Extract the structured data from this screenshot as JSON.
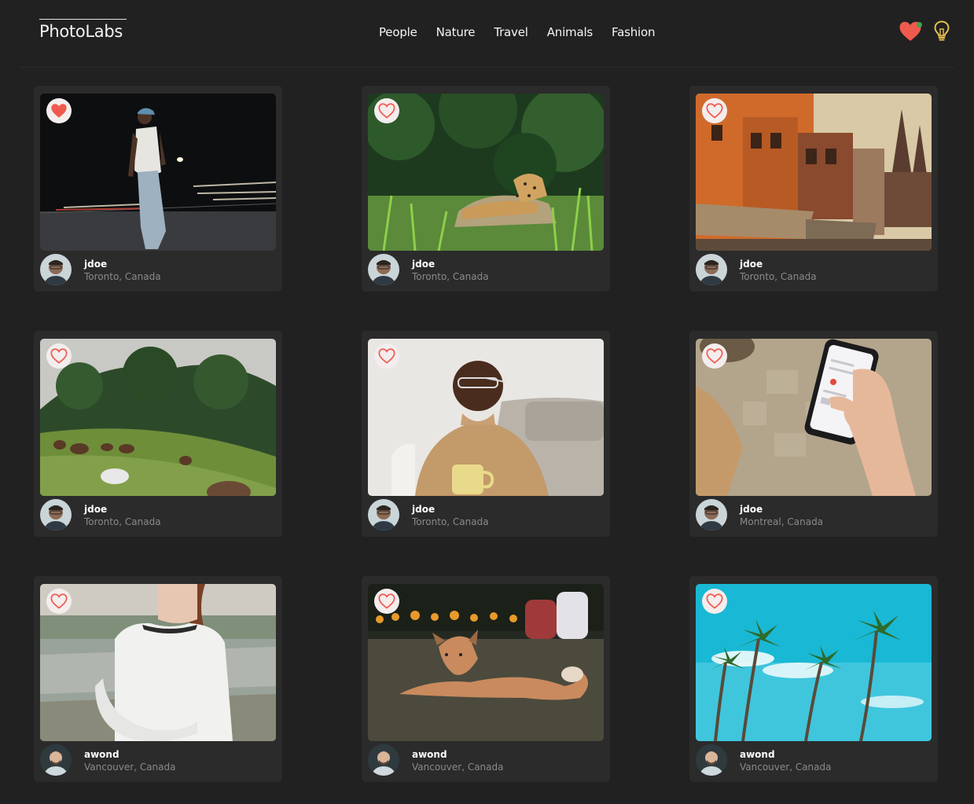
{
  "header": {
    "logo": "PhotoLabs",
    "topics": [
      "People",
      "Nature",
      "Travel",
      "Animals",
      "Fashion"
    ],
    "fav_icon": "heart-icon",
    "fav_notification_color": "#3fa34d",
    "theme_icon": "lightbulb-icon"
  },
  "colors": {
    "background": "#212121",
    "card": "#2b2b2b",
    "heart": "#f05a4e",
    "bulb": "#e6c24a"
  },
  "photos": [
    {
      "username": "jdoe",
      "location": "Toronto, Canada",
      "liked": true,
      "subject": "man-street-night"
    },
    {
      "username": "jdoe",
      "location": "Toronto, Canada",
      "liked": false,
      "subject": "jaguar-grass"
    },
    {
      "username": "jdoe",
      "location": "Toronto, Canada",
      "liked": false,
      "subject": "orange-buildings-street"
    },
    {
      "username": "jdoe",
      "location": "Toronto, Canada",
      "liked": false,
      "subject": "horses-hillside"
    },
    {
      "username": "jdoe",
      "location": "Toronto, Canada",
      "liked": false,
      "subject": "man-smiling-mug"
    },
    {
      "username": "jdoe",
      "location": "Montreal, Canada",
      "liked": false,
      "subject": "hand-holding-phone"
    },
    {
      "username": "awond",
      "location": "Vancouver, Canada",
      "liked": false,
      "subject": "woman-white-top"
    },
    {
      "username": "awond",
      "location": "Vancouver, Canada",
      "liked": false,
      "subject": "dog-lying-grass"
    },
    {
      "username": "awond",
      "location": "Vancouver, Canada",
      "liked": false,
      "subject": "palm-trees-sky"
    }
  ]
}
